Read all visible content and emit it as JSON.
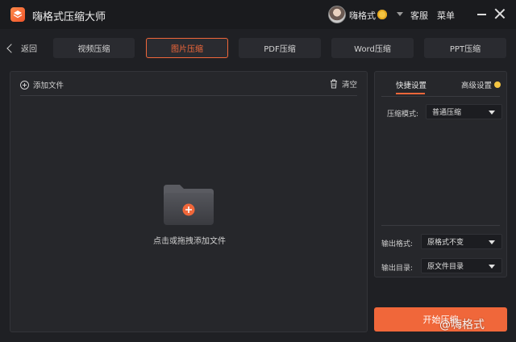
{
  "app": {
    "title": "嗨格式压缩大师"
  },
  "user": {
    "name": "嗨格式"
  },
  "header": {
    "service": "客服",
    "menu": "菜单"
  },
  "nav": {
    "back": "返回",
    "tabs": [
      {
        "label": "视频压缩",
        "active": false
      },
      {
        "label": "图片压缩",
        "active": true
      },
      {
        "label": "PDF压缩",
        "active": false
      },
      {
        "label": "Word压缩",
        "active": false
      },
      {
        "label": "PPT压缩",
        "active": false
      }
    ]
  },
  "main": {
    "add_file": "添加文件",
    "clear": "清空",
    "drop_hint": "点击或拖拽添加文件"
  },
  "settings": {
    "tab_quick": "快捷设置",
    "tab_advanced": "高级设置",
    "mode_label": "压缩模式:",
    "mode_value": "普通压缩",
    "format_label": "输出格式:",
    "format_value": "原格式不变",
    "dir_label": "输出目录:",
    "dir_value": "原文件目录"
  },
  "actions": {
    "start": "开始压缩"
  },
  "watermark": "@嗨格式",
  "colors": {
    "accent": "#f0673a",
    "bg": "#1f2024",
    "panel": "#26272b"
  }
}
